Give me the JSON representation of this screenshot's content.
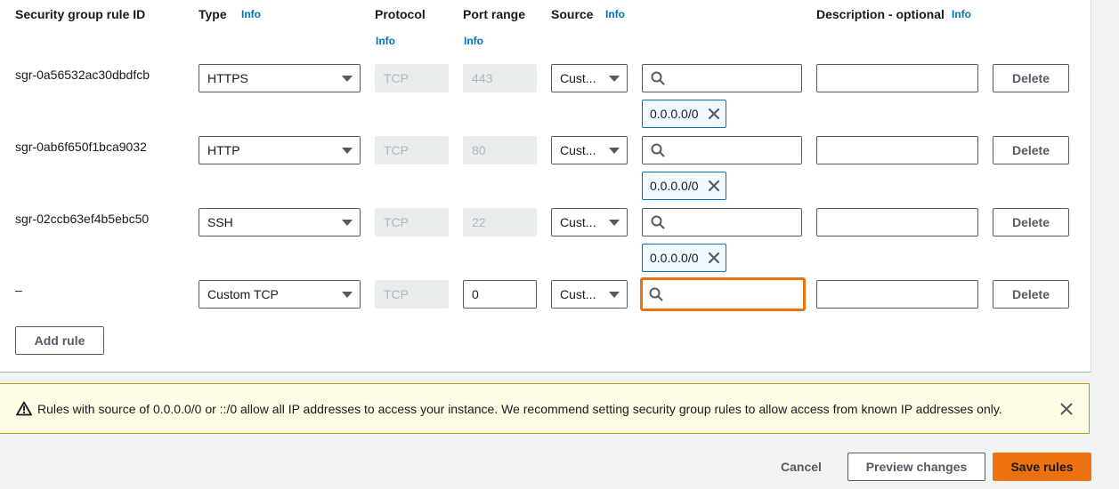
{
  "headers": {
    "rule_id": "Security group rule ID",
    "type": "Type",
    "type_info": "Info",
    "protocol": "Protocol",
    "protocol_info": "Info",
    "port_range": "Port range",
    "port_info": "Info",
    "source": "Source",
    "source_info": "Info",
    "description": "Description - optional",
    "description_info": "Info"
  },
  "rules": [
    {
      "id": "sgr-0a56532ac30dbdfcb",
      "type": "HTTPS",
      "protocol": "TCP",
      "port": "443",
      "source_type": "Cust...",
      "search_value": "",
      "cidr": "0.0.0.0/0",
      "description": "",
      "delete_label": "Delete"
    },
    {
      "id": "sgr-0ab6f650f1bca9032",
      "type": "HTTP",
      "protocol": "TCP",
      "port": "80",
      "source_type": "Cust...",
      "search_value": "",
      "cidr": "0.0.0.0/0",
      "description": "",
      "delete_label": "Delete"
    },
    {
      "id": "sgr-02ccb63ef4b5ebc50",
      "type": "SSH",
      "protocol": "TCP",
      "port": "22",
      "source_type": "Cust...",
      "search_value": "",
      "cidr": "0.0.0.0/0",
      "description": "",
      "delete_label": "Delete"
    },
    {
      "id": "–",
      "type": "Custom TCP",
      "protocol": "TCP",
      "port": "0",
      "source_type": "Cust...",
      "search_value": "",
      "description": "",
      "delete_label": "Delete"
    }
  ],
  "add_rule_label": "Add rule",
  "alert": {
    "message": "Rules with source of 0.0.0.0/0 or ::/0 allow all IP addresses to access your instance. We recommend setting security group rules to allow access from known IP addresses only.",
    "icon": "warning-icon",
    "close_icon": "close-icon"
  },
  "footer": {
    "cancel_label": "Cancel",
    "preview_label": "Preview changes",
    "save_label": "Save rules"
  },
  "colors": {
    "info_link": "#0073bb",
    "primary": "#ec7211",
    "focus": "#ec7211",
    "warning_bg": "#fffce6",
    "token_border": "#0073bb"
  }
}
